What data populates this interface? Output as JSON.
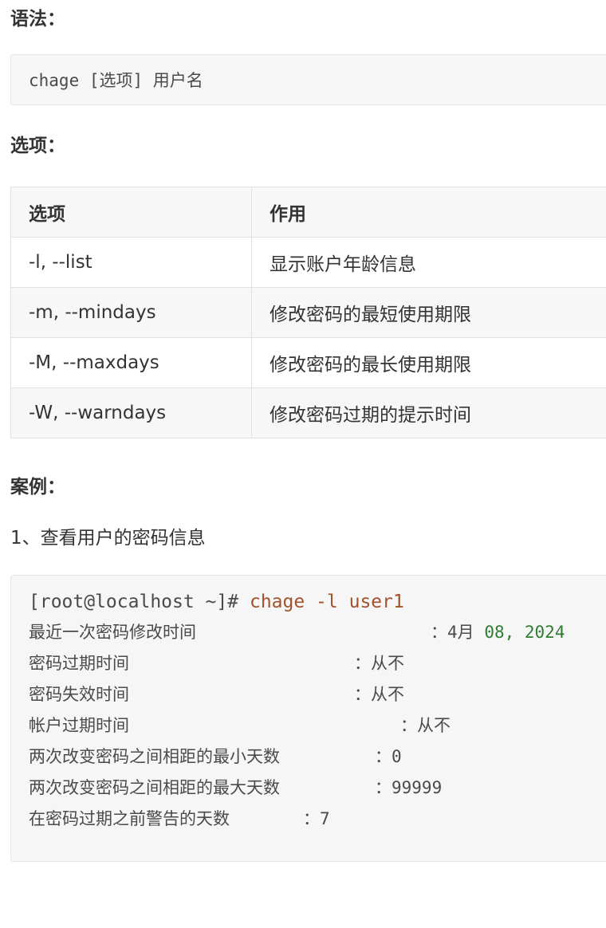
{
  "syntax": {
    "heading": "语法：",
    "code": "chage [选项] 用户名"
  },
  "options": {
    "heading": "选项：",
    "table": {
      "headers": [
        "选项",
        "作用"
      ],
      "rows": [
        [
          "-l, --list",
          "显示账户年龄信息"
        ],
        [
          "-m, --mindays",
          "修改密码的最短使用期限"
        ],
        [
          "-M, --maxdays",
          "修改密码的最长使用期限"
        ],
        [
          "-W, --warndays",
          "修改密码过期的提示时间"
        ]
      ]
    }
  },
  "example": {
    "heading": "案例：",
    "step1": "1、查看用户的密码信息",
    "prompt": "[root@localhost ~]#",
    "command": "chage -l user1",
    "output": [
      {
        "label": "最近一次密码修改时间",
        "sep": "：",
        "value_a": "4月",
        "value_b": "08, 2024"
      },
      {
        "label": "密码过期时间",
        "sep": "：",
        "value_a": "从不",
        "value_b": ""
      },
      {
        "label": "密码失效时间",
        "sep": "：",
        "value_a": "从不",
        "value_b": ""
      },
      {
        "label": "帐户过期时间",
        "sep": "：",
        "value_a": "从不",
        "value_b": ""
      },
      {
        "label": "两次改变密码之间相距的最小天数",
        "sep": "：",
        "value_a": "0",
        "value_b": ""
      },
      {
        "label": "两次改变密码之间相距的最大天数",
        "sep": "：",
        "value_a": "99999",
        "value_b": ""
      },
      {
        "label": "在密码过期之前警告的天数",
        "sep": "：",
        "value_a": "7",
        "value_b": ""
      }
    ]
  }
}
